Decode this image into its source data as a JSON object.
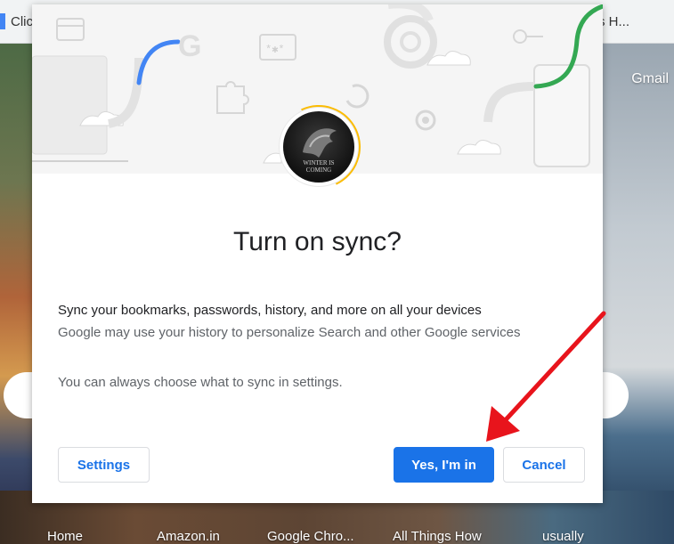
{
  "browser": {
    "tab_left_label": "Clic",
    "tab_right_label": "s H...",
    "gmail_link": "Gmail"
  },
  "shortcuts": [
    "Home",
    "Amazon.in",
    "Google Chro...",
    "All Things How",
    "usually"
  ],
  "dialog": {
    "title": "Turn on sync?",
    "line1": "Sync your bookmarks, passwords, history, and more on all your devices",
    "line2": "Google may use your history to personalize Search and other Google services",
    "line3": "You can always choose what to sync in settings.",
    "settings_button": "Settings",
    "confirm_button": "Yes, I'm in",
    "cancel_button": "Cancel",
    "avatar_caption": "WINTER IS COMING"
  },
  "colors": {
    "primary": "#1a73e8",
    "google_blue": "#4285f4",
    "google_green": "#34a853",
    "annotation_red": "#e8141c"
  }
}
